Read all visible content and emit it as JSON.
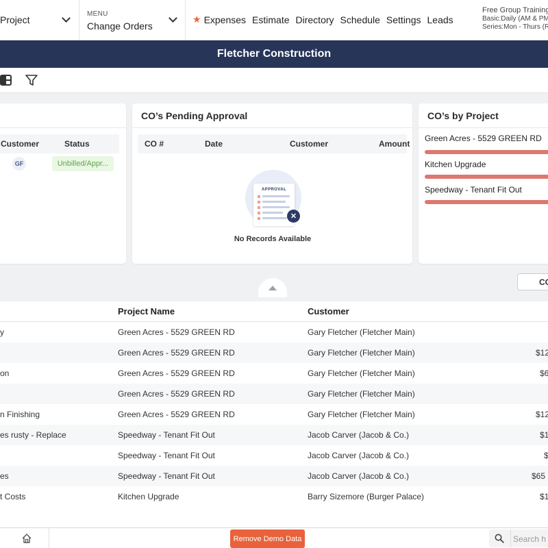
{
  "nav": {
    "project_label": "Project",
    "menu_small": "MENU",
    "menu_current": "Change Orders",
    "quick_links": [
      "Expenses",
      "Estimate",
      "Directory",
      "Schedule",
      "Settings",
      "Leads"
    ],
    "promo": {
      "line1": "Free Group Training",
      "line2": "Basic:Daily (AM & PM)",
      "line3": "Series:Mon - Thurs (R"
    },
    "star_color": "#e8673c"
  },
  "title": "Fletcher Construction",
  "toolbar": {
    "icons": [
      "layout-icon",
      "filter-icon"
    ]
  },
  "card1": {
    "headers": {
      "customer": "Customer",
      "status": "Status"
    },
    "row": {
      "initials": "GF",
      "status": "Unbilled/Appr..."
    }
  },
  "card2": {
    "title": "CO’s Pending Approval",
    "headers": {
      "co": "CO #",
      "date": "Date",
      "customer": "Customer",
      "amount": "Amount"
    },
    "illustration_label": "APPROVAL",
    "empty_text": "No Records Available"
  },
  "card3": {
    "title": "CO’s by Project",
    "projects": [
      "Green Acres - 5529 GREEN RD",
      "Kitchen Upgrade",
      "Speedway - Tenant Fit Out"
    ],
    "bar_color": "#dd786e"
  },
  "co_button": "CO",
  "table": {
    "headers": {
      "project": "Project Name",
      "customer": "Customer"
    },
    "rows": [
      {
        "title": "y",
        "project": "Green Acres - 5529 GREEN RD",
        "customer": "Gary Fletcher (Fletcher Main)",
        "amount": ""
      },
      {
        "title": "",
        "project": "Green Acres - 5529 GREEN RD",
        "customer": "Gary Fletcher (Fletcher Main)",
        "amount": "$12"
      },
      {
        "title": "on",
        "project": "Green Acres - 5529 GREEN RD",
        "customer": "Gary Fletcher (Fletcher Main)",
        "amount": "$6"
      },
      {
        "title": "",
        "project": "Green Acres - 5529 GREEN RD",
        "customer": "Gary Fletcher (Fletcher Main)",
        "amount": ""
      },
      {
        "title": "n Finishing",
        "project": "Green Acres - 5529 GREEN RD",
        "customer": "Gary Fletcher (Fletcher Main)",
        "amount": "$12"
      },
      {
        "title": "es rusty - Replace",
        "project": "Speedway - Tenant Fit Out",
        "customer": "Jacob Carver (Jacob & Co.)",
        "amount": "$1"
      },
      {
        "title": "",
        "project": "Speedway - Tenant Fit Out",
        "customer": "Jacob Carver (Jacob & Co.)",
        "amount": "$"
      },
      {
        "title": "es",
        "project": "Speedway - Tenant Fit Out",
        "customer": "Jacob Carver (Jacob & Co.)",
        "amount": "$65"
      },
      {
        "title": "t Costs",
        "project": "Kitchen Upgrade",
        "customer": "Barry Sizemore (Burger Palace)",
        "amount": "$1"
      }
    ]
  },
  "footer": {
    "remove_demo": "Remove Demo Data",
    "search_placeholder": "Search h",
    "accent": "#e8623b"
  },
  "colors": {
    "header_bg": "#263558",
    "status_green": "#5aa64a"
  }
}
